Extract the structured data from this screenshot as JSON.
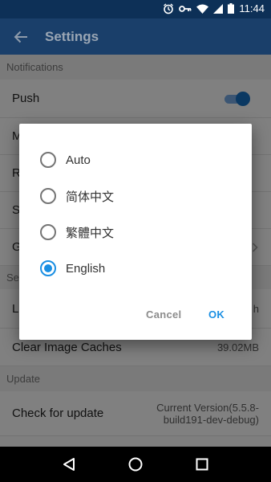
{
  "status_bar": {
    "time": "11:44"
  },
  "app_bar": {
    "title": "Settings"
  },
  "sections": {
    "notifications": "Notifications",
    "settings_partial": "Set",
    "update": "Update"
  },
  "rows": {
    "push": "Push",
    "row_m": "M",
    "row_r": "R",
    "row_s": "S",
    "row_g": "G",
    "language_partial": "L",
    "language_value_partial": "h",
    "clear_cache": "Clear Image Caches",
    "clear_cache_value": "39.02MB",
    "check_update": "Check for update",
    "version_line1": "Current Version(5.5.8-",
    "version_line2": "build191-dev-debug)"
  },
  "dialog": {
    "options": [
      "Auto",
      "简体中文",
      "繁體中文",
      "English"
    ],
    "selected": "English",
    "cancel": "Cancel",
    "ok": "OK"
  },
  "colors": {
    "accent": "#1a8fe3",
    "app_bar": "#1a3f6a",
    "status_bar": "#0d3057"
  }
}
